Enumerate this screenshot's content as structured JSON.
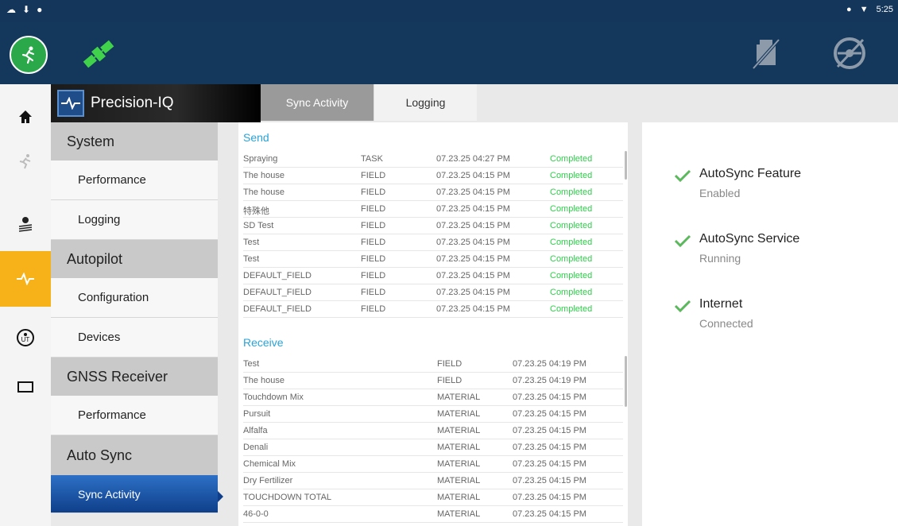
{
  "status_bar": {
    "time": "5:25"
  },
  "header": {
    "brand": "Precision-IQ"
  },
  "tabs": [
    {
      "label": "Sync Activity"
    },
    {
      "label": "Logging"
    }
  ],
  "menu": {
    "system": "System",
    "system_performance": "Performance",
    "system_logging": "Logging",
    "autopilot": "Autopilot",
    "autopilot_configuration": "Configuration",
    "autopilot_devices": "Devices",
    "gnss": "GNSS Receiver",
    "gnss_performance": "Performance",
    "autosync": "Auto Sync",
    "autosync_activity": "Sync Activity"
  },
  "send": {
    "title": "Send",
    "rows": [
      {
        "name": "Spraying",
        "type": "TASK",
        "time": "07.23.25 04:27 PM",
        "status": "Completed"
      },
      {
        "name": "The house",
        "type": "FIELD",
        "time": "07.23.25 04:15 PM",
        "status": "Completed"
      },
      {
        "name": "The house",
        "type": "FIELD",
        "time": "07.23.25 04:15 PM",
        "status": "Completed"
      },
      {
        "name": "特殊他",
        "type": "FIELD",
        "time": "07.23.25 04:15 PM",
        "status": "Completed"
      },
      {
        "name": "SD Test",
        "type": "FIELD",
        "time": "07.23.25 04:15 PM",
        "status": "Completed"
      },
      {
        "name": "Test",
        "type": "FIELD",
        "time": "07.23.25 04:15 PM",
        "status": "Completed"
      },
      {
        "name": "Test",
        "type": "FIELD",
        "time": "07.23.25 04:15 PM",
        "status": "Completed"
      },
      {
        "name": "DEFAULT_FIELD",
        "type": "FIELD",
        "time": "07.23.25 04:15 PM",
        "status": "Completed"
      },
      {
        "name": "DEFAULT_FIELD",
        "type": "FIELD",
        "time": "07.23.25 04:15 PM",
        "status": "Completed"
      },
      {
        "name": "DEFAULT_FIELD",
        "type": "FIELD",
        "time": "07.23.25 04:15 PM",
        "status": "Completed"
      }
    ]
  },
  "receive": {
    "title": "Receive",
    "rows": [
      {
        "name": "Test",
        "type": "FIELD",
        "time": "07.23.25 04:19 PM"
      },
      {
        "name": "The house",
        "type": "FIELD",
        "time": "07.23.25 04:19 PM"
      },
      {
        "name": "Touchdown Mix",
        "type": "MATERIAL",
        "time": "07.23.25 04:15 PM"
      },
      {
        "name": "Pursuit",
        "type": "MATERIAL",
        "time": "07.23.25 04:15 PM"
      },
      {
        "name": "Alfalfa",
        "type": "MATERIAL",
        "time": "07.23.25 04:15 PM"
      },
      {
        "name": "Denali",
        "type": "MATERIAL",
        "time": "07.23.25 04:15 PM"
      },
      {
        "name": "Chemical Mix",
        "type": "MATERIAL",
        "time": "07.23.25 04:15 PM"
      },
      {
        "name": "Dry Fertilizer",
        "type": "MATERIAL",
        "time": "07.23.25 04:15 PM"
      },
      {
        "name": "TOUCHDOWN TOTAL",
        "type": "MATERIAL",
        "time": "07.23.25 04:15 PM"
      },
      {
        "name": "46-0-0",
        "type": "MATERIAL",
        "time": "07.23.25 04:15 PM"
      }
    ]
  },
  "status": {
    "feature": {
      "title": "AutoSync Feature",
      "value": "Enabled"
    },
    "service": {
      "title": "AutoSync Service",
      "value": "Running"
    },
    "internet": {
      "title": "Internet",
      "value": "Connected"
    }
  },
  "colors": {
    "accent": "#29a3d8",
    "completed": "#2dd04a",
    "active_rail": "#f7b21a",
    "header": "#14375c"
  }
}
